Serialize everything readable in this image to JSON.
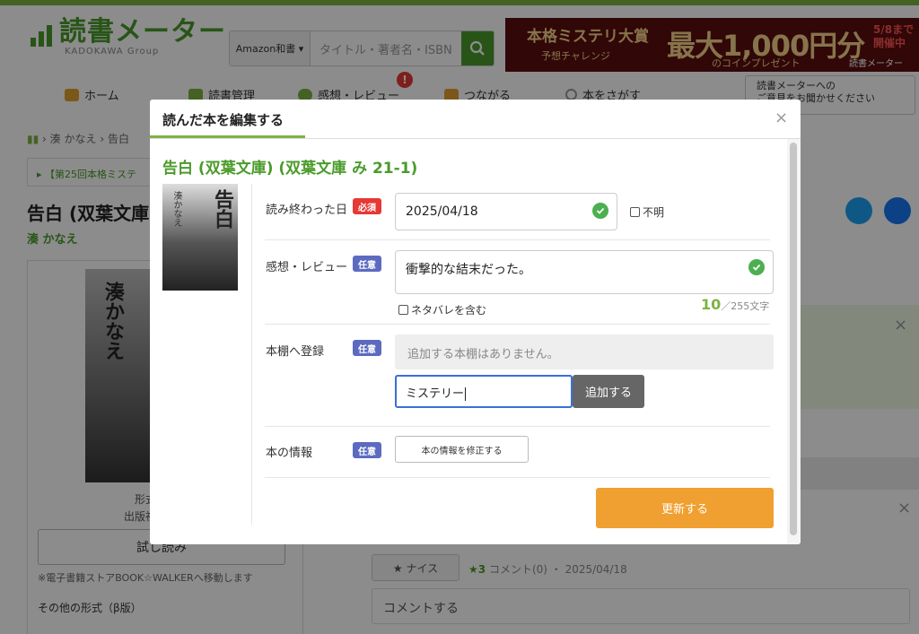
{
  "header": {
    "logo_text": "読書メーター",
    "logo_sub": "KADOKAWA Group",
    "search_select": "Amazon和書 ▾",
    "search_placeholder": "タイトル・著者名・ISBN",
    "banner": {
      "title": "本格ミステリ大賞",
      "sub": "予想チャレンジ",
      "amount": "最大1,000円分",
      "amount_sub": "のコインプレゼント",
      "deadline": "5/8まで\n開催中",
      "brand": "読書メーター"
    },
    "feedback_label": "読書メーターへの\nご意見をお聞かせください"
  },
  "nav": {
    "items": [
      {
        "label": "ホーム",
        "icon": "home-icon",
        "color": "#e0a030"
      },
      {
        "label": "読書管理",
        "icon": "book-icon",
        "color": "#7cb342"
      },
      {
        "label": "感想・レビュー",
        "icon": "speech-bubble-icon",
        "color": "#7cb342"
      },
      {
        "label": "つながる",
        "icon": "people-icon",
        "color": "#e0a030"
      },
      {
        "label": "本をさがす",
        "icon": "magnifier-icon",
        "color": "#999999"
      }
    ],
    "badge": "!"
  },
  "page": {
    "breadcrumb_author": "湊 かなえ",
    "breadcrumb_book": "告白",
    "notice": "【第25回本格ミステ",
    "title": "告白 (双葉文庫)",
    "author": "湊 かなえ",
    "cover_author": "湊かなえ",
    "meta1": "形式",
    "meta2": "出版社",
    "trial_button": "試し読み",
    "ebook_note": "※電子書籍ストアBOOK☆WALKERへ移動します",
    "other_formats": "その他の形式（β版）",
    "nice_button": "★ ナイス",
    "review_stars": "★3",
    "review_meta": "コメント(0) ・ 2025/04/18",
    "comment_button": "コメントする"
  },
  "modal": {
    "title": "読んだ本を編集する",
    "close": "×",
    "book_title": "告白 (双葉文庫) (双葉文庫 み 21-1)",
    "cover_title": "告白",
    "cover_author": "湊かなえ",
    "finish_date": {
      "label": "読み終わった日",
      "tag": "必須",
      "value": "2025/04/18",
      "unknown_label": "不明"
    },
    "review": {
      "label": "感想・レビュー",
      "tag": "任意",
      "value": "衝撃的な結末だった。",
      "spoiler_label": "ネタバレを含む",
      "count": "10",
      "count_max": "／255文字"
    },
    "shelf": {
      "label": "本棚へ登録",
      "tag": "任意",
      "empty_text": "追加する本棚はありません。",
      "input_value": "ミステリー",
      "add_button": "追加する"
    },
    "info": {
      "label": "本の情報",
      "tag": "任意",
      "fix_button": "本の情報を修正する"
    },
    "update_button": "更新する"
  }
}
